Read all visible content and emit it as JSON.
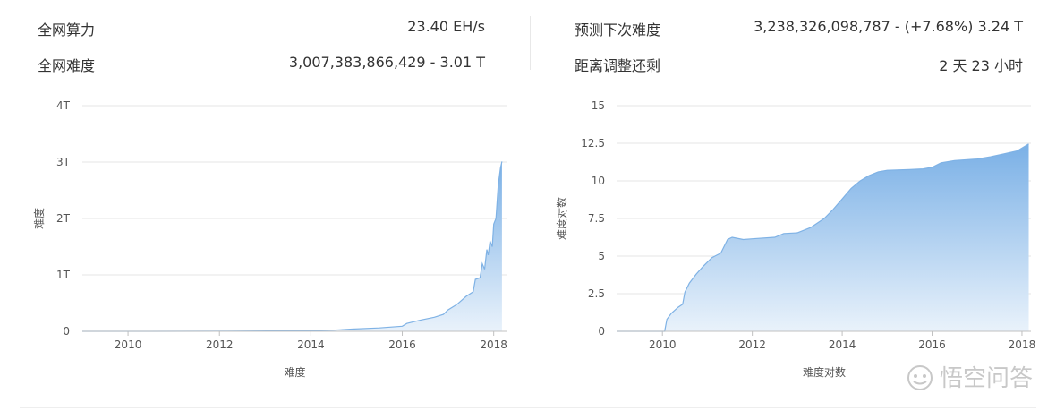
{
  "stats": {
    "left": [
      {
        "label": "全网算力",
        "value": "23.40 EH/s"
      },
      {
        "label": "全网难度",
        "value": "3,007,383,866,429 - 3.01 T"
      }
    ],
    "right": [
      {
        "label": "预测下次难度",
        "value": "3,238,326,098,787 - (+7.68%) 3.24 T"
      },
      {
        "label": "距离调整还剩",
        "value": "2 天 23 小时"
      }
    ]
  },
  "colors": {
    "line": "#7fb2e5",
    "fill_top": "#7ab0e6",
    "fill_bottom": "#e9f2fb",
    "grid": "#e6e6e6",
    "text": "#333333",
    "axis_text": "#555555"
  },
  "watermark_text": "悟空问答",
  "chart_data": [
    {
      "type": "area",
      "xlabel": "难度",
      "ylabel": "难度",
      "x_ticks": [
        "2010",
        "2012",
        "2014",
        "2016",
        "2018"
      ],
      "y_ticks": [
        "0",
        "1T",
        "2T",
        "3T",
        "4T"
      ],
      "xlim": [
        2009.0,
        2018.3
      ],
      "ylim": [
        0,
        4
      ],
      "y_unit": "T",
      "grid": true,
      "series": [
        {
          "x": [
            2009.0,
            2010.5,
            2012.0,
            2013.5,
            2014.5,
            2014.9,
            2015.5,
            2016.0,
            2016.1,
            2016.4,
            2016.7,
            2016.9,
            2017.0,
            2017.2,
            2017.4,
            2017.55,
            2017.6,
            2017.7,
            2017.75,
            2017.8,
            2017.85,
            2017.88,
            2017.92,
            2017.97,
            2018.0,
            2018.05,
            2018.1,
            2018.15,
            2018.18
          ],
          "y": [
            0.0,
            0.0,
            0.002,
            0.008,
            0.02,
            0.04,
            0.06,
            0.09,
            0.14,
            0.2,
            0.25,
            0.3,
            0.38,
            0.48,
            0.62,
            0.7,
            0.92,
            0.95,
            1.2,
            1.1,
            1.45,
            1.35,
            1.6,
            1.5,
            1.9,
            2.0,
            2.6,
            2.9,
            3.01
          ]
        }
      ]
    },
    {
      "type": "area",
      "xlabel": "难度对数",
      "ylabel": "难度对数",
      "x_ticks": [
        "2010",
        "2012",
        "2014",
        "2016",
        "2018"
      ],
      "y_ticks": [
        "0",
        "2.5",
        "5",
        "7.5",
        "10",
        "12.5",
        "15"
      ],
      "xlim": [
        2009.0,
        2018.2
      ],
      "ylim": [
        0,
        15
      ],
      "grid": true,
      "series": [
        {
          "x": [
            2009.0,
            2010.05,
            2010.1,
            2010.2,
            2010.35,
            2010.45,
            2010.5,
            2010.6,
            2010.75,
            2010.9,
            2011.1,
            2011.3,
            2011.45,
            2011.55,
            2011.8,
            2012.0,
            2012.5,
            2012.7,
            2013.0,
            2013.3,
            2013.6,
            2013.8,
            2014.0,
            2014.2,
            2014.4,
            2014.6,
            2014.8,
            2015.0,
            2015.5,
            2015.8,
            2016.0,
            2016.2,
            2016.5,
            2017.0,
            2017.3,
            2017.6,
            2017.9,
            2018.15
          ],
          "y": [
            0.0,
            0.0,
            0.8,
            1.2,
            1.6,
            1.8,
            2.6,
            3.2,
            3.8,
            4.3,
            4.9,
            5.2,
            6.1,
            6.25,
            6.1,
            6.15,
            6.25,
            6.5,
            6.55,
            6.9,
            7.5,
            8.1,
            8.8,
            9.5,
            10.0,
            10.35,
            10.6,
            10.7,
            10.75,
            10.8,
            10.9,
            11.2,
            11.35,
            11.45,
            11.6,
            11.8,
            12.0,
            12.45
          ]
        }
      ]
    }
  ]
}
